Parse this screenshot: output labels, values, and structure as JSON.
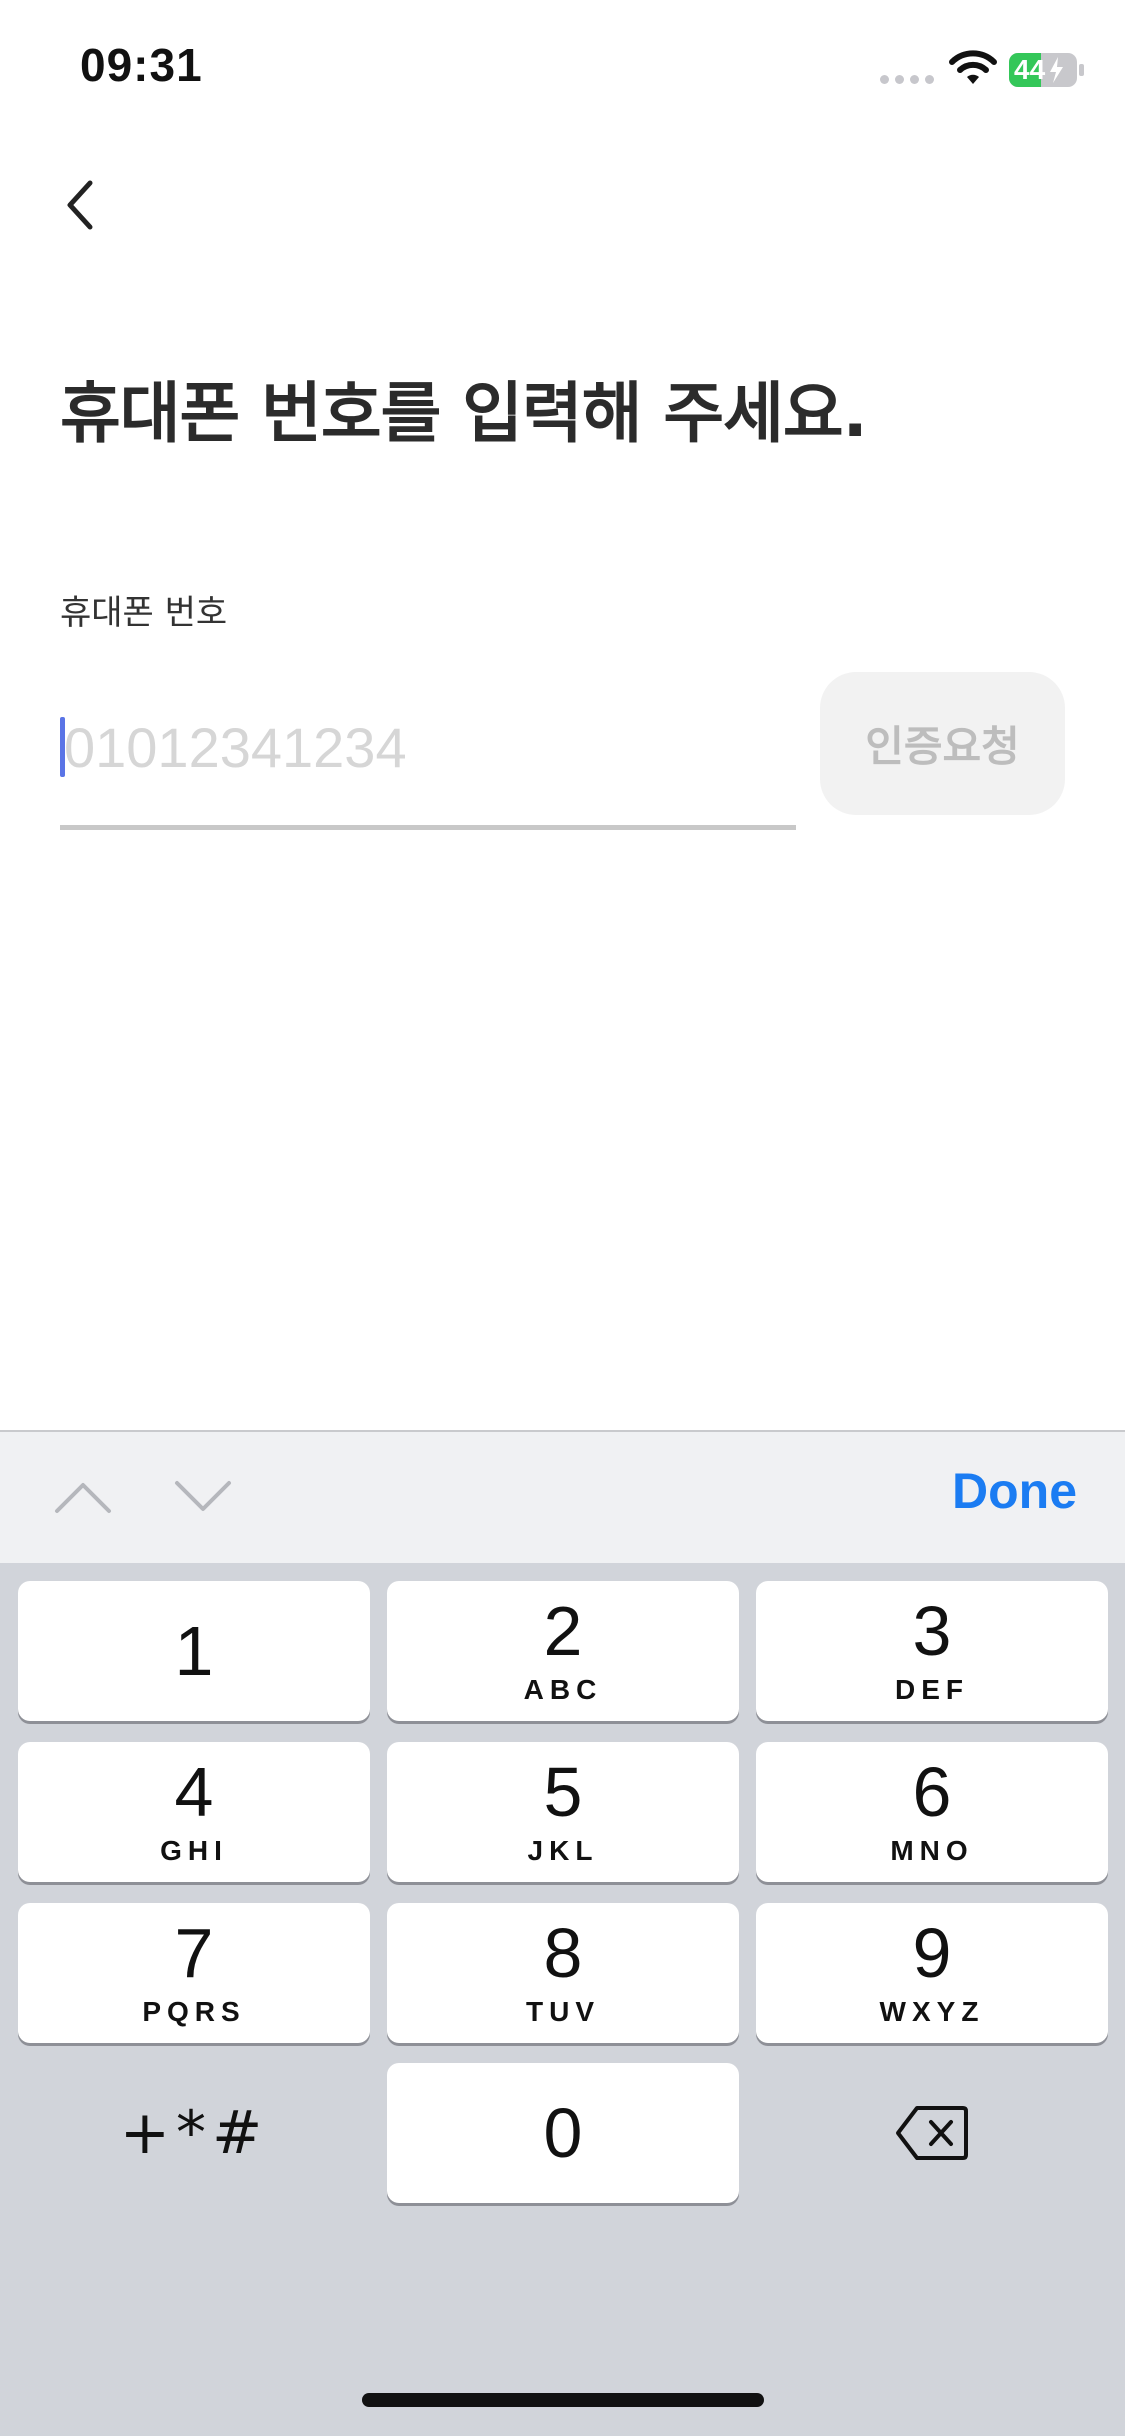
{
  "status_bar": {
    "time": "09:31",
    "battery_level": "44",
    "icons": [
      "signal-dots-icon",
      "wifi-icon",
      "battery-charging-icon"
    ],
    "battery_color": "#34c759"
  },
  "header": {
    "back_icon": "chevron-left-icon"
  },
  "title": "휴대폰 번호를 입력해 주세요.",
  "form": {
    "phone_label": "휴대폰 번호",
    "phone_value": "",
    "phone_placeholder": "01012341234",
    "verify_button_label": "인증요청"
  },
  "accessory_bar": {
    "prev_icon": "chevron-up-icon",
    "next_icon": "chevron-down-icon",
    "done_label": "Done",
    "done_color": "#1b7cf2"
  },
  "keypad": {
    "keys": [
      {
        "num": "1",
        "letters": ""
      },
      {
        "num": "2",
        "letters": "ABC"
      },
      {
        "num": "3",
        "letters": "DEF"
      },
      {
        "num": "4",
        "letters": "GHI"
      },
      {
        "num": "5",
        "letters": "JKL"
      },
      {
        "num": "6",
        "letters": "MNO"
      },
      {
        "num": "7",
        "letters": "PQRS"
      },
      {
        "num": "8",
        "letters": "TUV"
      },
      {
        "num": "9",
        "letters": "WXYZ"
      },
      {
        "num": "0",
        "letters": ""
      }
    ],
    "symbols_label": "+*#",
    "delete_icon": "backspace-icon"
  }
}
